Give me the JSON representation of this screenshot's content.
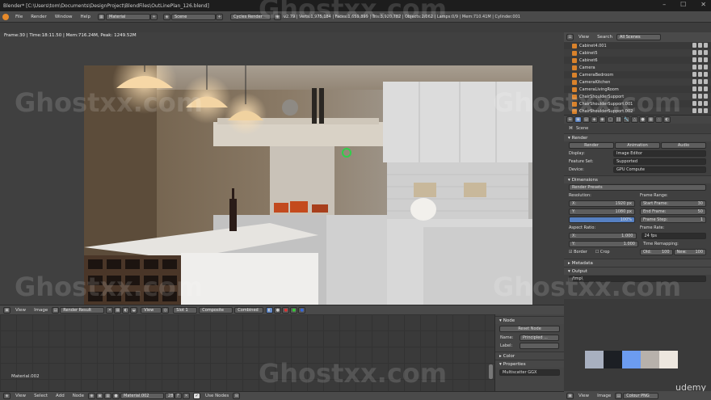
{
  "window": {
    "title": "Blender* [C:\\Users\\tom\\Documents\\DesignProject\\BlendFiles\\OutLinePlan_126.blend]",
    "buttons": [
      "–",
      "☐",
      "✕"
    ]
  },
  "info_header": {
    "menus": [
      "File",
      "Render",
      "Window",
      "Help"
    ],
    "screen": "Material",
    "scene": "Scene",
    "engine": "Cycles Render",
    "stats": "v2.79 | Verts:1,975,184 | Faces:1,659,899 | Tris:3,920,782 | Objects:2/062 | Lamps:0/9 | Mem:710.41M | Cylinder.001"
  },
  "image_editor": {
    "frame_line1": "Frame:30 | Time:18:11.50 | Mem:716.24M, Peak: 1249.52M",
    "frame_line2": "",
    "header": {
      "menus": [
        "View",
        "Image"
      ],
      "image": "Render Result",
      "view": "View",
      "slot": "Slot 1",
      "layer": "Composite",
      "pass": "Combined"
    }
  },
  "node_editor": {
    "material_label": "Material.002",
    "panel": {
      "node_title": "Node",
      "reset_node": "Reset Node",
      "name_label": "Name:",
      "name_value": "Principled ...",
      "label_label": "Label:",
      "color_title": "Color",
      "properties_title": "Properties",
      "multiscatter": "Multiscatter GGX"
    },
    "header": {
      "menus": [
        "View",
        "Select",
        "Add",
        "Node"
      ],
      "material": "Material.002",
      "users": "28",
      "use_nodes": "Use Nodes"
    }
  },
  "outliner": {
    "header": {
      "view": "View",
      "search": "Search",
      "scenes": "All Scenes"
    },
    "items": [
      "Cabinet4.001",
      "Cabinet5",
      "Cabinet6",
      "Camera",
      "CameraBedroom",
      "CameraKitchen",
      "CameraLivingRoom",
      "ChairShoulderSupport",
      "ChairShoulderSupport.001",
      "ChairShoulderSupport.002"
    ]
  },
  "properties": {
    "scene_label": "Scene",
    "render_section": "Render",
    "render_buttons": [
      "Render",
      "Animation",
      "Audio"
    ],
    "display_label": "Display:",
    "display_value": "Image Editor",
    "feature_label": "Feature Set:",
    "feature_value": "Supported",
    "device_label": "Device:",
    "device_value": "GPU Compute",
    "dimensions_section": "Dimensions",
    "presets": "Render Presets",
    "resolution_label": "Resolution:",
    "res_x_label": "X:",
    "res_x": "1920 px",
    "res_y_label": "Y:",
    "res_y": "1080 px",
    "res_pct": "100%",
    "frame_range_label": "Frame Range:",
    "start_label": "Start Frame:",
    "start": "30",
    "end_label": "End Frame:",
    "end": "50",
    "step_label": "Frame Step:",
    "step": "1",
    "aspect_label": "Aspect Ratio:",
    "asp_x_label": "X:",
    "asp_x": "1.000",
    "asp_y_label": "Y:",
    "asp_y": "1.000",
    "frame_rate_label": "Frame Rate:",
    "fps": "24 fps",
    "remap_label": "Time Remapping:",
    "old_label": "Old:",
    "old": "100",
    "new_label": "New:",
    "new": "100",
    "border_label": "Border",
    "crop_label": "Crop",
    "metadata_section": "Metadata",
    "output_section": "Output",
    "output_path": "/tmp\\"
  },
  "palette": {
    "colors": [
      "#a8b0c0",
      "#1c1f24",
      "#6c9cf0",
      "#b7b1ab",
      "#ede7df"
    ]
  },
  "rb_header": {
    "menus": [
      "View",
      "Image"
    ],
    "format": "Colour PNG"
  },
  "watermarks": [
    "Ghostxx.com",
    "Ghostxx.com",
    "Ghostxx.com",
    "Ghostxx.com",
    "Ghostxx.com",
    "Ghostxx.com",
    "Ghostxx.com"
  ],
  "udemy": "udemy"
}
